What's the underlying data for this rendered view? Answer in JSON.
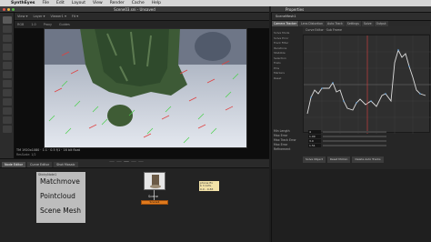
{
  "menubar": {
    "apple": "",
    "items": [
      "SynthEyes",
      "File",
      "Edit",
      "Layout",
      "View",
      "Render",
      "Cache",
      "Help"
    ]
  },
  "viewer_window": {
    "title": "Scene03.sni - Unsaved"
  },
  "properties_window": {
    "title": "Properties"
  },
  "viewer": {
    "toolbar_items": [
      "View ▾",
      "Layer ▾",
      "Viewer1 ▾",
      "Fit ▾"
    ],
    "toolbar2_items": [
      "RGB",
      "1.0",
      "Proxy",
      "Guides"
    ],
    "status": "TM 1920x1080 · 1:1 · 0.5 f/1 · 16 bit float",
    "status2": "ResScale: 1/2"
  },
  "node_tabs": [
    "Node Editor",
    "Curve Editor",
    "Shot Mosaic"
  ],
  "sticky_note": {
    "title": "StickyNote1",
    "lines": [
      "Matchmove",
      "Pointcloud",
      "Scene Mesh"
    ]
  },
  "scene_node": {
    "label": "Scene",
    "name": "Scene1"
  },
  "note_node": {
    "lines": [
      "phone fix",
      "b 3 10%",
      "0.0 - 0.83"
    ]
  },
  "properties": {
    "header": "SceneMesh1",
    "tabs": [
      "Camera Tracker",
      "Lens Distortion",
      "Auto Track",
      "Settings",
      "Solve",
      "Output",
      "Advanced"
    ],
    "rows": [
      "Solve Mode",
      "Solve Error",
      "Track Filter",
      "Iterations",
      "Stabilize",
      "Selection",
      "Trails",
      "Pins",
      "Markers",
      "Reset"
    ],
    "curve_toolbar": "Curve Editor · Sub Frame",
    "params": [
      {
        "label": "Min Length",
        "value": "4"
      },
      {
        "label": "Max Error",
        "value": "1.00"
      },
      {
        "label": "Max Track Error",
        "value": "3.0"
      },
      {
        "label": "Max Error",
        "value": "1.51"
      },
      {
        "label": "Refinement",
        "value": ""
      }
    ],
    "lower_buttons": [
      "Solve Object",
      "Reset Motion",
      "Delete Auto Tracks"
    ]
  }
}
